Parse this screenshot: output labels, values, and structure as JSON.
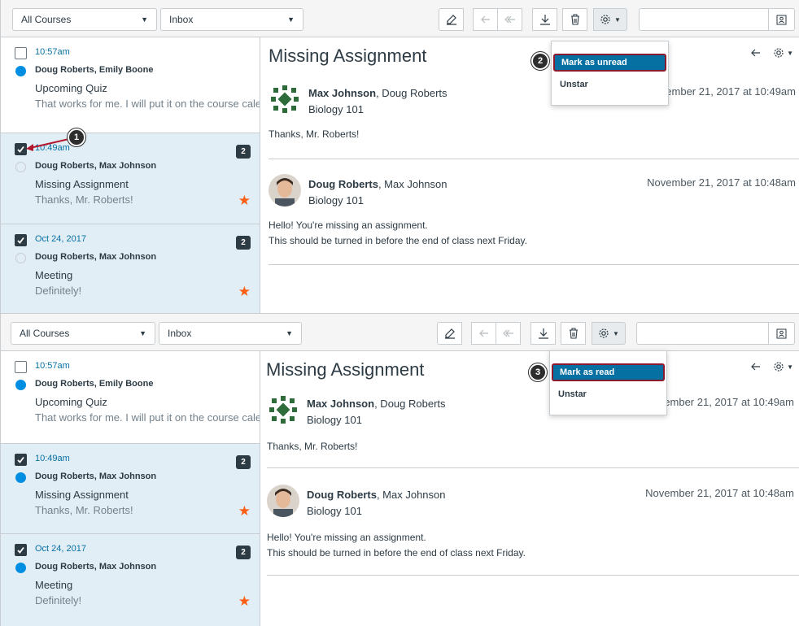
{
  "colors": {
    "accent": "#0770a3",
    "unread_dot": "#008ee2",
    "star": "#fc5e13",
    "callout_border": "#8b1a2e"
  },
  "panels": [
    {
      "toolbar": {
        "course_filter": "All Courses",
        "mailbox_filter": "Inbox"
      },
      "conversations": [
        {
          "date": "10:57am",
          "participants": "Doug Roberts, Emily Boone",
          "subject": "Upcoming Quiz",
          "preview": "That works for me. I will put it on the course calendar.",
          "checked": false,
          "read_state": "unread",
          "selected": false
        },
        {
          "date": "10:49am",
          "participants": "Doug Roberts, Max Johnson",
          "subject": "Missing Assignment",
          "preview": "Thanks, Mr. Roberts!",
          "count": "2",
          "checked": true,
          "read_state": "read",
          "selected": true
        },
        {
          "date": "Oct 24, 2017",
          "participants": "Doug Roberts, Max Johnson",
          "subject": "Meeting",
          "preview": "Definitely!",
          "count": "2",
          "checked": true,
          "read_state": "read",
          "selected": true
        }
      ],
      "message_view": {
        "title": "Missing Assignment",
        "messages": [
          {
            "author": "Max Johnson",
            "others": ", Doug Roberts",
            "course": "Biology 101",
            "date": "November 21, 2017 at 10:49am",
            "body": [
              "Thanks, Mr. Roberts!"
            ]
          },
          {
            "author": "Doug Roberts",
            "others": ", Max Johnson",
            "course": "Biology 101",
            "date": "November 21, 2017 at 10:48am",
            "body": [
              "Hello! You're missing an assignment.",
              "This should be turned in before the end of class next Friday."
            ]
          }
        ]
      },
      "dropdown": {
        "items": [
          "Mark as unread",
          "Unstar"
        ]
      },
      "callouts": [
        "1",
        "2"
      ]
    },
    {
      "toolbar": {
        "course_filter": "All Courses",
        "mailbox_filter": "Inbox"
      },
      "conversations": [
        {
          "date": "10:57am",
          "participants": "Doug Roberts, Emily Boone",
          "subject": "Upcoming Quiz",
          "preview": "That works for me. I will put it on the course calendar.",
          "checked": false,
          "read_state": "unread",
          "selected": false
        },
        {
          "date": "10:49am",
          "participants": "Doug Roberts, Max Johnson",
          "subject": "Missing Assignment",
          "preview": "Thanks, Mr. Roberts!",
          "count": "2",
          "checked": true,
          "read_state": "unread",
          "selected": true
        },
        {
          "date": "Oct 24, 2017",
          "participants": "Doug Roberts, Max Johnson",
          "subject": "Meeting",
          "preview": "Definitely!",
          "count": "2",
          "checked": true,
          "read_state": "unread",
          "selected": true
        }
      ],
      "message_view": {
        "title": "Missing Assignment",
        "messages": [
          {
            "author": "Max Johnson",
            "others": ", Doug Roberts",
            "course": "Biology 101",
            "date": "November 21, 2017 at 10:49am",
            "body": [
              "Thanks, Mr. Roberts!"
            ]
          },
          {
            "author": "Doug Roberts",
            "others": ", Max Johnson",
            "course": "Biology 101",
            "date": "November 21, 2017 at 10:48am",
            "body": [
              "Hello! You're missing an assignment.",
              "This should be turned in before the end of class next Friday."
            ]
          }
        ]
      },
      "dropdown": {
        "items": [
          "Mark as read",
          "Unstar"
        ]
      },
      "callouts": [
        "3"
      ]
    }
  ]
}
